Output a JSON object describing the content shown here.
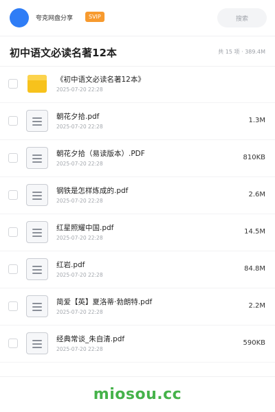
{
  "header": {
    "share_name": "夸克网盘分享",
    "badge": "SVIP",
    "search_placeholder": "搜索",
    "avatar_color": "#2f7df6",
    "badge_color": "#f79a2e"
  },
  "folder": {
    "title": "初中语文必读名著12本",
    "meta": "共 15 项 · 389.4M"
  },
  "files": [
    {
      "icon": "folder-icon",
      "name": "《初中语文必读名著12本》",
      "date": "2025-07-20 22:28",
      "size": ""
    },
    {
      "icon": "document-icon",
      "name": "朝花夕拾.pdf",
      "date": "2025-07-20 22:28",
      "size": "1.3M"
    },
    {
      "icon": "document-icon",
      "name": "朝花夕拾（易读版本）.PDF",
      "date": "2025-07-20 22:28",
      "size": "810KB"
    },
    {
      "icon": "document-icon",
      "name": "钢铁是怎样炼成的.pdf",
      "date": "2025-07-20 22:28",
      "size": "2.6M"
    },
    {
      "icon": "document-icon",
      "name": "红星照耀中国.pdf",
      "date": "2025-07-20 22:28",
      "size": "14.5M"
    },
    {
      "icon": "document-icon",
      "name": "红岩.pdf",
      "date": "2025-07-20 22:28",
      "size": "84.8M"
    },
    {
      "icon": "document-icon",
      "name": "简爱【英】夏洛蒂·勃朗特.pdf",
      "date": "2025-07-20 22:28",
      "size": "2.2M"
    },
    {
      "icon": "document-icon",
      "name": "经典常谈_朱自清.pdf",
      "date": "2025-07-20 22:28",
      "size": "590KB"
    }
  ],
  "footer": {
    "brand": "miosou.cc",
    "brand_color": "#45b24a"
  }
}
